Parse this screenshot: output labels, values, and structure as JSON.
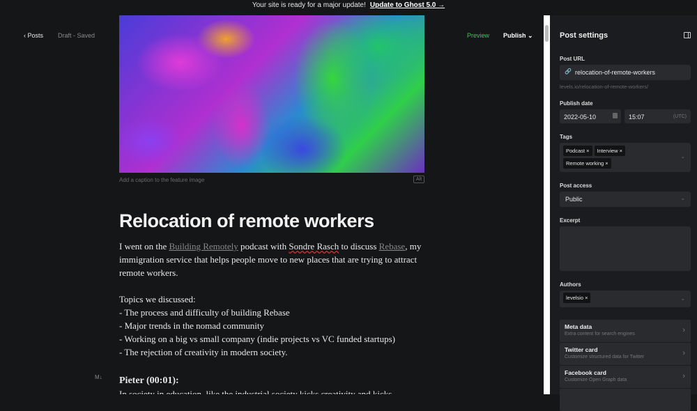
{
  "banner": {
    "text": "Your site is ready for a major update!",
    "link": "Update to Ghost 5.0 →"
  },
  "topbar": {
    "back": "‹  Posts",
    "status": "Draft - Saved",
    "preview": "Preview",
    "publish": "Publish ⌄"
  },
  "editor": {
    "caption_placeholder": "Add a caption to the feature image",
    "alt_label": "Alt",
    "title": "Relocation of remote workers",
    "p1": {
      "a": "I went on the ",
      "link1": "Building Remotely",
      "b": " podcast with ",
      "name": "Sondre Rasch",
      "c": " to discuss ",
      "link2": "Rebase",
      "d": ", my immigration service that helps people move to new places that are trying to attract remote workers."
    },
    "topics_heading": "Topics we discussed:",
    "topics": [
      "- The process and difficulty of building Rebase",
      "- Major trends in the nomad community",
      "- Working on a big vs small company (indie projects vs VC funded startups)",
      "- The rejection of creativity in modern society."
    ],
    "markdown_badge": "M↓",
    "speaker": "Pieter (00:01):",
    "last_line": "In society in education, like the industrial society kicks creativity and kicks"
  },
  "sidebar": {
    "title": "Post settings",
    "post_url_label": "Post URL",
    "post_url": "relocation-of-remote-workers",
    "post_url_hint": "levels.io/relocation-of-remote-workers/",
    "publish_date_label": "Publish date",
    "date": "2022-05-10",
    "time": "15:07",
    "tz": "(UTC)",
    "tags_label": "Tags",
    "tags": [
      "Podcast ×",
      "Interview ×",
      "Remote working ×"
    ],
    "access_label": "Post access",
    "access": "Public",
    "excerpt_label": "Excerpt",
    "authors_label": "Authors",
    "authors": [
      "levelsio ×"
    ],
    "cards": [
      {
        "title": "Meta data",
        "sub": "Extra content for search engines"
      },
      {
        "title": "Twitter card",
        "sub": "Customize structured data for Twitter"
      },
      {
        "title": "Facebook card",
        "sub": "Customize Open Graph data"
      }
    ]
  }
}
